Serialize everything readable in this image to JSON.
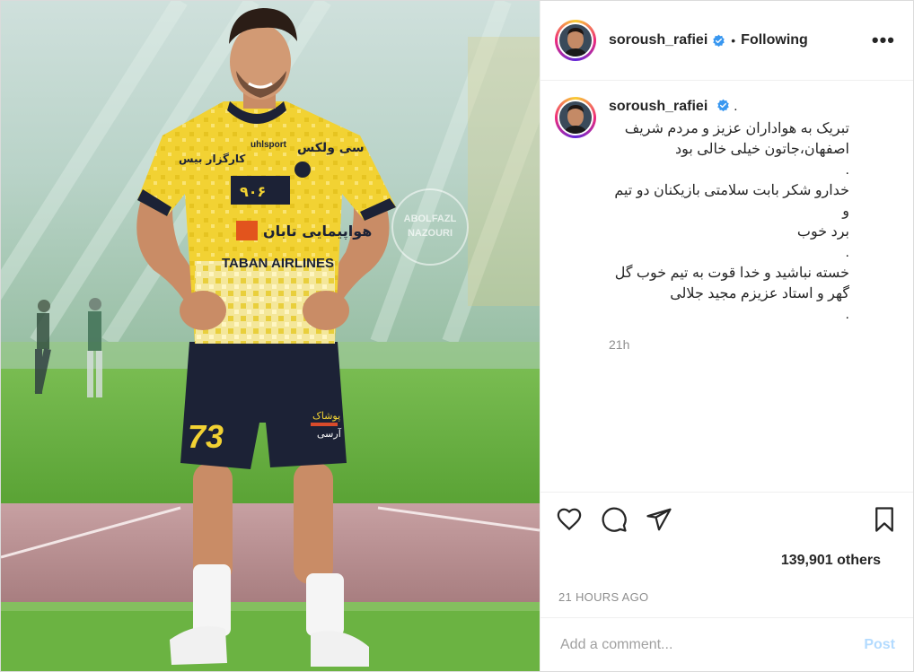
{
  "post": {
    "username": "soroush_rafiei",
    "verified": true,
    "separator": "•",
    "follow_status": "Following",
    "more": "•••",
    "caption_suffix": ".",
    "caption": "تبریک به هواداران عزیز و مردم شریف\nاصفهان،جاتون خیلی خالی بود\n.\nخدارو شکر بابت سلامتی بازیکنان دو تیم و\nبرد خوب\n.\nخسته نباشید و خدا قوت به تیم خوب گل\nگهر و استاد عزیزم مجید جلالی\n.",
    "caption_time": "21h",
    "likes": "139,901 others",
    "posted_ago": "21 HOURS AGO",
    "comment_placeholder": "Add a comment...",
    "post_button": "Post"
  },
  "photo": {
    "sponsor": "TABAN AIRLINES",
    "shirt_number": "73",
    "watermark_top": "ABOLFAZL",
    "watermark_bottom": "NAZOURI",
    "kit_brand": "uhlsport",
    "sponsor_fa": "هواپیمایی تابان",
    "sponsor_top_fa": "سی ولکس",
    "sponsor_side_fa": "کارگزار بیس"
  },
  "icons": [
    "heart-icon",
    "comment-icon",
    "share-icon",
    "bookmark-icon",
    "verified-badge-icon",
    "more-options-icon"
  ],
  "colors": {
    "verified": "#3897f0",
    "post_disabled": "#b3dbff",
    "secondary_text": "#8e8e8e",
    "jersey_yellow": "#f2d233"
  }
}
